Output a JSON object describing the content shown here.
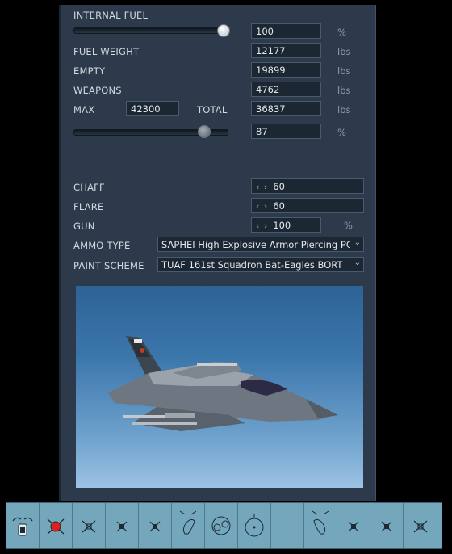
{
  "fuel": {
    "internal_fuel_label": "INTERNAL FUEL",
    "internal_fuel_value": "100",
    "internal_fuel_unit": "%",
    "internal_fuel_slider_fraction": 1.0,
    "fuel_weight_label": "FUEL WEIGHT",
    "fuel_weight_value": "12177",
    "fuel_weight_unit": "lbs",
    "empty_label": "EMPTY",
    "empty_value": "19899",
    "empty_unit": "lbs",
    "weapons_label": "WEAPONS",
    "weapons_value": "4762",
    "weapons_unit": "lbs",
    "max_label": "MAX",
    "max_value": "42300",
    "total_label": "TOTAL",
    "total_value": "36837",
    "total_unit": "lbs",
    "load_percent_value": "87",
    "load_percent_unit": "%",
    "load_slider_fraction": 0.87
  },
  "countermeasures": {
    "chaff_label": "CHAFF",
    "chaff_value": "60",
    "flare_label": "FLARE",
    "flare_value": "60",
    "gun_label": "GUN",
    "gun_value": "100",
    "gun_unit": "%",
    "stepper_arrows": "‹ ›"
  },
  "options": {
    "ammo_type_label": "AMMO TYPE",
    "ammo_type_value": "SAPHEI High Explosive Armor Piercing PC",
    "paint_scheme_label": "PAINT SCHEME",
    "paint_scheme_value": "TUAF 161st Squadron Bat-Eagles BORT"
  },
  "toolbar": {
    "buttons": [
      "aircraft-nose-icon",
      "weapon-remove-icon",
      "pylon-icon",
      "pylon-icon",
      "pylon-icon",
      "fuel-tank-icon",
      "pod-pair-icon",
      "center-store-icon",
      "empty-slot",
      "fuel-tank-icon",
      "pylon-icon",
      "pylon-icon",
      "pylon-icon"
    ]
  },
  "colors": {
    "panel_bg": "#2c3a4b",
    "field_bg": "#1c2734",
    "toolbar_bg": "#74a7bc",
    "remove_red": "#e02020"
  }
}
